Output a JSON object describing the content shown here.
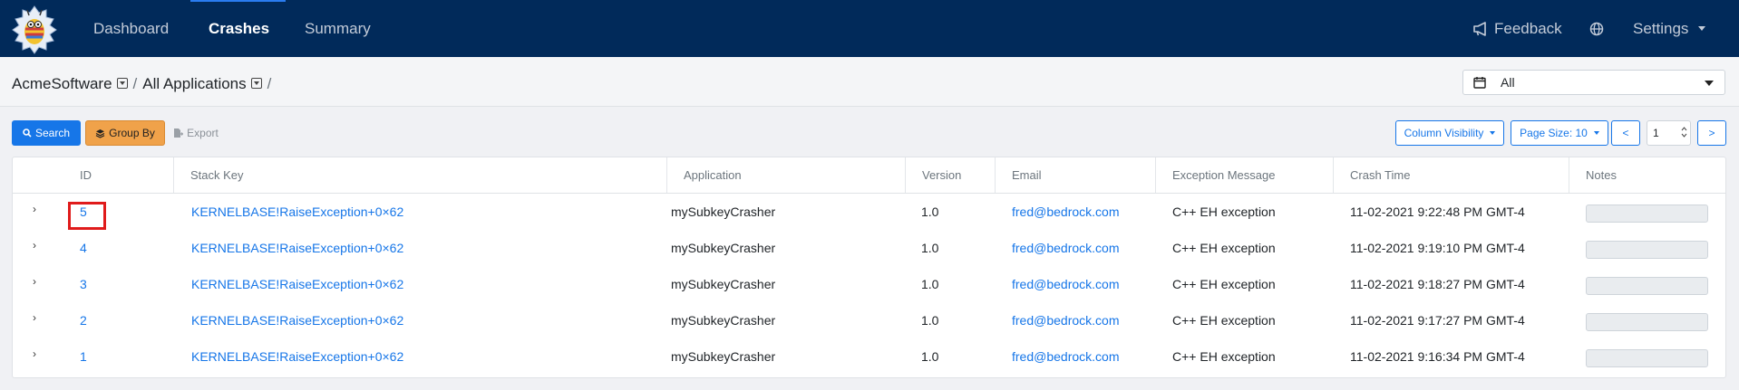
{
  "nav": {
    "items": [
      "Dashboard",
      "Crashes",
      "Summary"
    ],
    "active": "Crashes",
    "feedback": "Feedback",
    "settings": "Settings"
  },
  "breadcrumb": {
    "org": "AcmeSoftware",
    "app": "All Applications",
    "separator": "/"
  },
  "date_filter": {
    "value": "All"
  },
  "toolbar": {
    "search": "Search",
    "group_by": "Group By",
    "export": "Export",
    "column_visibility": "Column Visibility",
    "page_size": "Page Size: 10",
    "prev": "<",
    "next": ">",
    "page_value": "1"
  },
  "table": {
    "headers": [
      "ID",
      "Stack Key",
      "Application",
      "Version",
      "Email",
      "Exception Message",
      "Crash Time",
      "Notes"
    ],
    "rows": [
      {
        "id": "5",
        "stack_key": "KERNELBASE!RaiseException+0×62",
        "application": "mySubkeyCrasher",
        "version": "1.0",
        "email": "fred@bedrock.com",
        "exception": "C++ EH exception",
        "time": "11-02-2021 9:22:48 PM GMT-4"
      },
      {
        "id": "4",
        "stack_key": "KERNELBASE!RaiseException+0×62",
        "application": "mySubkeyCrasher",
        "version": "1.0",
        "email": "fred@bedrock.com",
        "exception": "C++ EH exception",
        "time": "11-02-2021 9:19:10 PM GMT-4"
      },
      {
        "id": "3",
        "stack_key": "KERNELBASE!RaiseException+0×62",
        "application": "mySubkeyCrasher",
        "version": "1.0",
        "email": "fred@bedrock.com",
        "exception": "C++ EH exception",
        "time": "11-02-2021 9:18:27 PM GMT-4"
      },
      {
        "id": "2",
        "stack_key": "KERNELBASE!RaiseException+0×62",
        "application": "mySubkeyCrasher",
        "version": "1.0",
        "email": "fred@bedrock.com",
        "exception": "C++ EH exception",
        "time": "11-02-2021 9:17:27 PM GMT-4"
      },
      {
        "id": "1",
        "stack_key": "KERNELBASE!RaiseException+0×62",
        "application": "mySubkeyCrasher",
        "version": "1.0",
        "email": "fred@bedrock.com",
        "exception": "C++ EH exception",
        "time": "11-02-2021 9:16:34 PM GMT-4"
      }
    ]
  },
  "colors": {
    "navbar": "#012a5a",
    "primary": "#1676e8",
    "warning": "#f0a24a",
    "highlight": "#e01b1b"
  },
  "icons": [
    "app-logo-icon",
    "megaphone-icon",
    "globe-icon",
    "calendar-icon",
    "search-icon",
    "layers-icon",
    "export-icon",
    "chevron-right-icon"
  ]
}
